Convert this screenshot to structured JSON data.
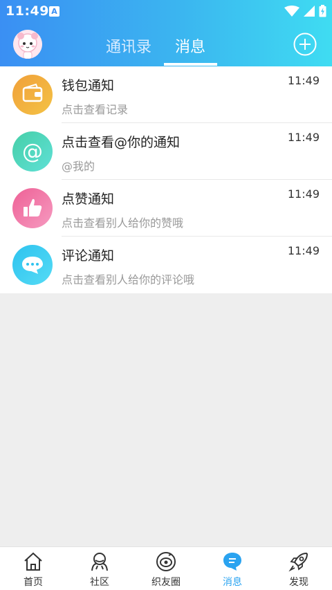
{
  "status": {
    "time": "11:49",
    "app_badge": "A"
  },
  "tabs": [
    {
      "label": "通讯录"
    },
    {
      "label": "消息"
    }
  ],
  "messages": [
    {
      "title": "钱包通知",
      "subtitle": "点击查看记录",
      "time": "11:49",
      "icon": "wallet-icon",
      "color": "#f3a63a"
    },
    {
      "title": "点击查看@你的通知",
      "subtitle": "@我的",
      "time": "11:49",
      "icon": "at-icon",
      "color": "#4fd9c1"
    },
    {
      "title": "点赞通知",
      "subtitle": "点击查看别人给你的赞哦",
      "time": "11:49",
      "icon": "thumbs-up-icon",
      "color": "#f06fa1"
    },
    {
      "title": "评论通知",
      "subtitle": "点击查看别人给你的评论哦",
      "time": "11:49",
      "icon": "comment-icon",
      "color": "#3fcdf0"
    }
  ],
  "bottom_nav": [
    {
      "label": "首页",
      "icon": "home-icon"
    },
    {
      "label": "社区",
      "icon": "community-icon"
    },
    {
      "label": "织友圈",
      "icon": "circle-icon"
    },
    {
      "label": "消息",
      "icon": "message-icon",
      "active": true
    },
    {
      "label": "发现",
      "icon": "rocket-icon"
    }
  ],
  "colors": {
    "accent": "#2aa3f0",
    "header_start": "#3a8ff3",
    "header_end": "#3fdcf2",
    "background": "#eeeeee"
  }
}
